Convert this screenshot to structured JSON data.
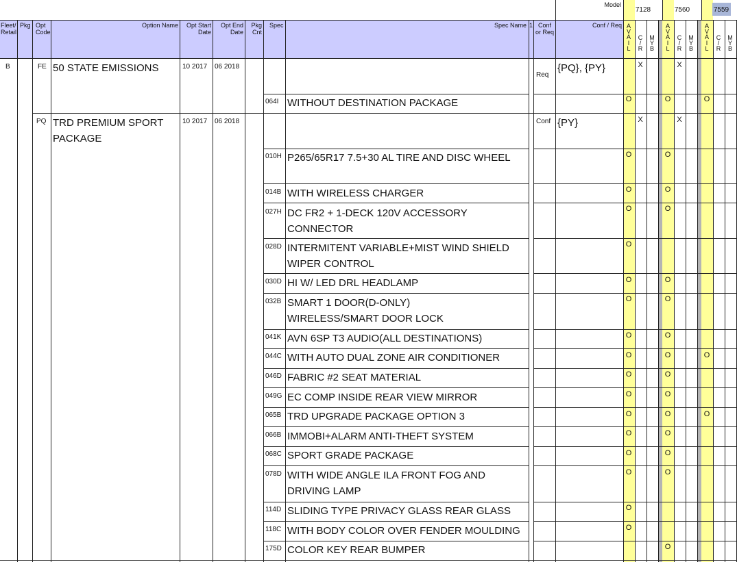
{
  "header": {
    "model_label": "Model",
    "models": [
      "7128",
      "7560",
      "7559"
    ],
    "columns": {
      "fleet_retail": "Fleet/\nRetail",
      "pkg": "Pkg",
      "opt_code": "Opt\nCode",
      "option_name": "Option Name",
      "opt_start": "Opt Start\nDate",
      "opt_end": "Opt End\nDate",
      "pkg_cnt": "Pkg\nCnt",
      "spec": "Spec",
      "spec_name": "Spec Name",
      "spec_name_suffix": "1",
      "conf_req": "Conf\nor Req",
      "conf_req2": "Conf / Req",
      "avail": "A\nV\nA\nI\nL",
      "cr": "C\n/\nR",
      "myb": "M\nY\nB"
    }
  },
  "options": [
    {
      "fleet_retail": "B",
      "opt_code": "FE",
      "option_name": "50 STATE EMISSIONS",
      "opt_start": "10 2017",
      "opt_end": "06 2018",
      "conf_or_req": "Req",
      "conf_req_list": "{PQ}, {PY}"
    },
    {
      "opt_code": "PQ",
      "option_name": "TRD PREMIUM SPORT PACKAGE",
      "opt_start": "10 2017",
      "opt_end": "06 2018",
      "conf_or_req": "Conf",
      "conf_req_list": "{PY}"
    }
  ],
  "specs": [
    {
      "code": "064I",
      "name": "WITHOUT DESTINATION PACKAGE"
    },
    {
      "code": "010H",
      "name": "P265/65R17  7.5+30 AL TIRE AND DISC WHEEL"
    },
    {
      "code": "014B",
      "name": "WITH WIRELESS CHARGER"
    },
    {
      "code": "027H",
      "name": "DC FR2 + 1-DECK 120V ACCESSORY CONNECTOR"
    },
    {
      "code": "028D",
      "name": "INTERMITENT VARIABLE+MIST WIND SHIELD WIPER CONTROL"
    },
    {
      "code": "030D",
      "name": "HI W/ LED DRL HEADLAMP"
    },
    {
      "code": "032B",
      "name": "SMART 1 DOOR(D-ONLY) WIRELESS/SMART DOOR LOCK"
    },
    {
      "code": "041K",
      "name": "AVN 6SP T3 AUDIO(ALL DESTINATIONS)"
    },
    {
      "code": "044C",
      "name": "WITH AUTO DUAL ZONE AIR CONDITIONER"
    },
    {
      "code": "046D",
      "name": "FABRIC #2 SEAT MATERIAL"
    },
    {
      "code": "049G",
      "name": "EC COMP INSIDE REAR VIEW MIRROR"
    },
    {
      "code": "065B",
      "name": "TRD UPGRADE PACKAGE OPTION 3"
    },
    {
      "code": "066B",
      "name": "IMMOBI+ALARM ANTI-THEFT SYSTEM"
    },
    {
      "code": "068C",
      "name": "SPORT GRADE PACKAGE"
    },
    {
      "code": "078D",
      "name": "WITH WIDE ANGLE ILA FRONT FOG AND DRIVING LAMP"
    },
    {
      "code": "114D",
      "name": "SLIDING TYPE PRIVACY GLASS REAR GLASS"
    },
    {
      "code": "118C",
      "name": "WITH BODY COLOR OVER FENDER MOULDING"
    },
    {
      "code": "175D",
      "name": "COLOR KEY REAR BUMPER"
    }
  ],
  "marks": {
    "x": "X",
    "o": "O"
  }
}
